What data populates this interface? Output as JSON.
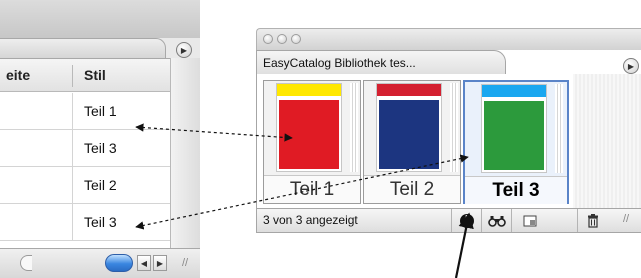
{
  "table_panel": {
    "columns": [
      "eite",
      "Stil"
    ],
    "rows": [
      {
        "style": "Teil 1"
      },
      {
        "style": "Teil 3"
      },
      {
        "style": "Teil 2"
      },
      {
        "style": "Teil 3"
      }
    ],
    "icons": {
      "menu": "circle-triangle-right-icon",
      "scroll_left": "triangle-left-icon",
      "scroll_right": "triangle-right-icon",
      "resize": "resize-grip-icon"
    }
  },
  "library_palette": {
    "tab_title": "EasyCatalog Bibliothek tes...",
    "status": "3 von 3 angezeigt",
    "items": [
      {
        "label": "Teil 1",
        "strip_color": "#ffe800",
        "block_color": "#e01b24",
        "selected": false
      },
      {
        "label": "Teil 2",
        "strip_color": "#d42030",
        "block_color": "#1c3580",
        "selected": false
      },
      {
        "label": "Teil 3",
        "strip_color": "#1aa7f0",
        "block_color": "#2c9a3c",
        "selected": true
      }
    ],
    "toolbar_icons": [
      "info-icon",
      "binoculars-icon",
      "new-item-icon",
      "trash-icon"
    ],
    "window_controls": [
      "close-light",
      "minimize-light",
      "zoom-light"
    ]
  },
  "colors": {
    "selection_border": "#5a84c8",
    "scroll_thumb": "#3a86e0"
  }
}
